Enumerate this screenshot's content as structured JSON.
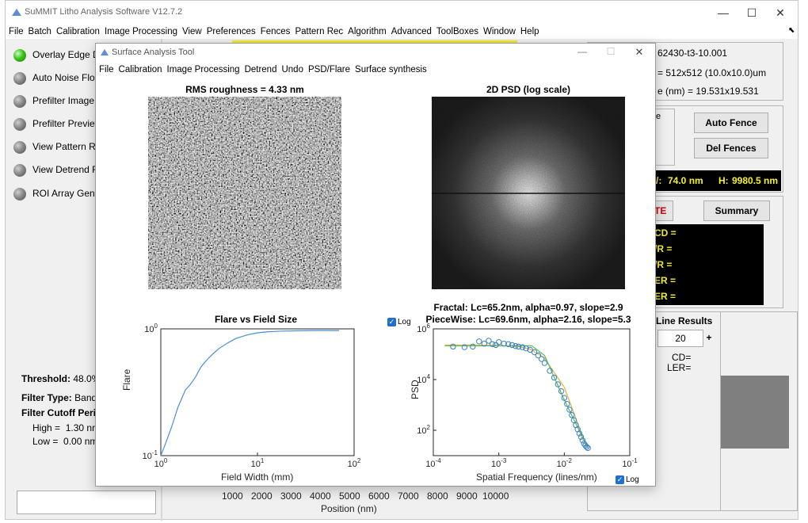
{
  "main_window": {
    "title": "SuMMIT Litho Analysis Software V12.7.2",
    "controls": {
      "minimize": "—",
      "maximize": "☐",
      "close": "✕"
    },
    "menu": [
      "File",
      "Batch",
      "Calibration",
      "Image Processing",
      "View",
      "Preferences",
      "Fences",
      "Pattern Rec",
      "Algorithm",
      "Advanced",
      "ToolBoxes",
      "Window",
      "Help"
    ],
    "pin_glyph": "⬉"
  },
  "left_panel": {
    "options": [
      {
        "label": "Overlay Edge Da",
        "state": "on"
      },
      {
        "label": "Auto Noise Floor",
        "state": "off"
      },
      {
        "label": "Prefilter Image",
        "state": "off"
      },
      {
        "label": "Prefilter Preview",
        "state": "off"
      },
      {
        "label": "View Pattern Rec",
        "state": "off"
      },
      {
        "label": "View Detrend Re",
        "state": "off"
      },
      {
        "label": "ROI Array Gener",
        "state": "off"
      }
    ],
    "threshold_label": "Threshold:",
    "threshold_value": "48.0%",
    "filter_type_label": "Filter Type:",
    "filter_type_value": "BandP",
    "filter_cutoff_label": "Filter Cutoff Perio",
    "high_label": "High =",
    "high_value": "1.30 nm",
    "low_label": "Low =",
    "low_value": "0.00 nm"
  },
  "position_axis": {
    "ticks": [
      "1000",
      "2000",
      "3000",
      "4000",
      "5000",
      "6000",
      "7000",
      "8000",
      "9000",
      "10000"
    ],
    "label": "Position (nm)"
  },
  "right_panel": {
    "info": {
      "filename": "62430-t3-10.001",
      "image_size": "= 512x512 (10.0x10.0)um",
      "pixel_size": "e (nm) = 19.531x19.531"
    },
    "fence_box_label": "e",
    "auto_fence_button": "Auto Fence",
    "del_fences_button": "Del Fences",
    "measure": {
      "w_label": "/:",
      "w_value": "74.0 nm",
      "h_label": "H:",
      "h_value": "9980.5 nm"
    },
    "te_label": "TE",
    "summary_button": "Summary",
    "results_rows": [
      "CD =",
      "/R =",
      "/R =",
      "ER =",
      "ER ="
    ],
    "line_results": {
      "title": "Line Results",
      "count": "20",
      "plus": "+",
      "cd_label": "CD=",
      "ler_label": "LER="
    }
  },
  "surface_tool": {
    "title": "Surface Analysis Tool",
    "controls": {
      "minimize": "—",
      "maximize": "☐",
      "close": "✕"
    },
    "menu": [
      "File",
      "Calibration",
      "Image Processing",
      "Detrend",
      "Undo",
      "PSD/Flare",
      "Surface synthesis"
    ],
    "pin_glyph": "⬉",
    "rms_title": "RMS roughness = 4.33 nm",
    "psd2d_title": "2D PSD (log scale)",
    "flare_title": "Flare vs Field Size",
    "fit_title_1": "Fractal: Lc=65.2nm, alpha=0.97, slope=2.9",
    "fit_title_2": "PieceWise: Lc=69.6nm, alpha=2.16, slope=5.3",
    "log_label_top": "Log",
    "log_label_bottom": "Log",
    "check_glyph": "✓"
  },
  "chart_data": [
    {
      "type": "line",
      "title": "Flare vs Field Size",
      "xlabel": "Field Width (mm)",
      "ylabel": "Flare",
      "xscale": "log",
      "yscale": "log",
      "xlim": [
        1,
        100
      ],
      "ylim": [
        0.1,
        1
      ],
      "x_ticks": [
        "10^0",
        "10^1",
        "10^2"
      ],
      "y_ticks": [
        "10^-1",
        "10^0"
      ],
      "grid": false,
      "line_color": "#4a90d9",
      "series": [
        {
          "x": [
            1.0,
            1.1,
            1.3,
            1.5,
            1.8,
            2.0,
            2.3,
            2.6,
            3.0,
            3.5,
            4.0,
            5.0,
            6.0,
            8.0,
            10,
            13,
            18,
            25,
            40,
            70
          ],
          "y": [
            0.1,
            0.12,
            0.17,
            0.24,
            0.33,
            0.36,
            0.42,
            0.5,
            0.57,
            0.64,
            0.7,
            0.78,
            0.84,
            0.9,
            0.93,
            0.95,
            0.96,
            0.965,
            0.97,
            0.97
          ]
        }
      ]
    },
    {
      "type": "scatter",
      "title": "Fractal: Lc=65.2nm, alpha=0.97, slope=2.9 / PieceWise: Lc=69.6nm, alpha=2.16, slope=5.3",
      "xlabel": "Spatial Frequency (lines/nm)",
      "ylabel": "PSD",
      "xscale": "log",
      "yscale": "log",
      "xlim": [
        0.0001,
        0.1
      ],
      "ylim": [
        10,
        1000000
      ],
      "x_ticks": [
        "10^-4",
        "10^-3",
        "10^-2",
        "10^-1"
      ],
      "y_ticks": [
        "10^2",
        "10^4",
        "10^6"
      ],
      "grid": false,
      "marker_color": "#3a82c4",
      "fit_colors": [
        "#e6b84a",
        "#5cc05c"
      ],
      "series": [
        {
          "x": [
            0.0002,
            0.0003,
            0.0004,
            0.0005,
            0.0006,
            0.0007,
            0.0008,
            0.0009,
            0.001,
            0.0012,
            0.0014,
            0.0016,
            0.0018,
            0.002,
            0.0023,
            0.0026,
            0.003,
            0.0035,
            0.004,
            0.0045,
            0.005,
            0.006,
            0.007,
            0.008,
            0.009,
            0.01,
            0.011,
            0.012,
            0.013,
            0.014,
            0.015,
            0.016,
            0.017,
            0.018,
            0.019,
            0.02,
            0.021,
            0.022,
            0.023
          ],
          "y": [
            200000,
            190000,
            200000,
            320000,
            260000,
            340000,
            250000,
            230000,
            300000,
            260000,
            250000,
            230000,
            210000,
            200000,
            190000,
            170000,
            150000,
            120000,
            90000,
            65000,
            45000,
            22000,
            12000,
            6500,
            3500,
            1900,
            1100,
            650,
            400,
            250,
            160,
            110,
            75,
            55,
            40,
            30,
            25,
            22,
            20
          ]
        },
        {
          "name": "Fractal",
          "x": [
            0.00015,
            0.0005,
            0.001,
            0.002,
            0.003,
            0.005,
            0.01,
            0.02,
            0.023
          ],
          "y": [
            230000,
            228000,
            222000,
            200000,
            160000,
            70000,
            5000,
            40,
            22
          ]
        },
        {
          "name": "PieceWise",
          "x": [
            0.00015,
            0.001,
            0.002,
            0.0032,
            0.005,
            0.01,
            0.02,
            0.023
          ],
          "y": [
            215000,
            215000,
            215000,
            215000,
            90000,
            1600,
            40,
            20
          ]
        }
      ]
    }
  ]
}
